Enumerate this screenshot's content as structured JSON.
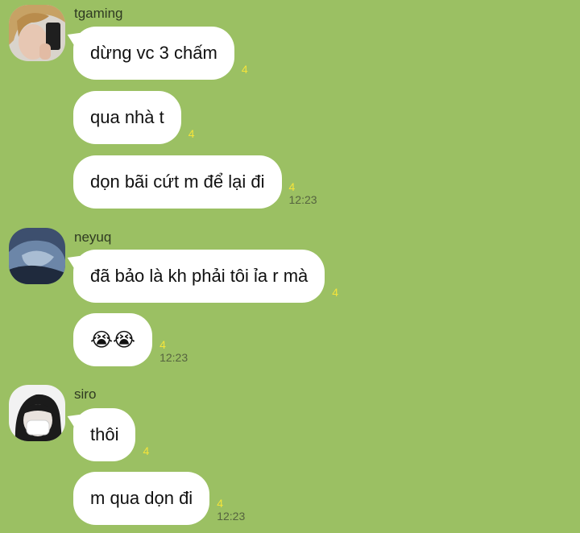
{
  "groups": [
    {
      "sender": "tgaming",
      "messages": [
        {
          "text": "dừng vc 3 chấm",
          "count": "4",
          "time": ""
        },
        {
          "text": "qua nhà t",
          "count": "4",
          "time": ""
        },
        {
          "text": "dọn bãi cứt m để lại đi",
          "count": "4",
          "time": "12:23"
        }
      ]
    },
    {
      "sender": "neyuq",
      "messages": [
        {
          "text": "đã bảo là kh phải tôi ỉa r mà",
          "count": "4",
          "time": ""
        },
        {
          "text": "😭😭",
          "count": "4",
          "time": "12:23"
        }
      ]
    },
    {
      "sender": "siro",
      "messages": [
        {
          "text": "thôi",
          "count": "4",
          "time": ""
        },
        {
          "text": "m qua dọn đi",
          "count": "4",
          "time": "12:23"
        }
      ]
    }
  ]
}
